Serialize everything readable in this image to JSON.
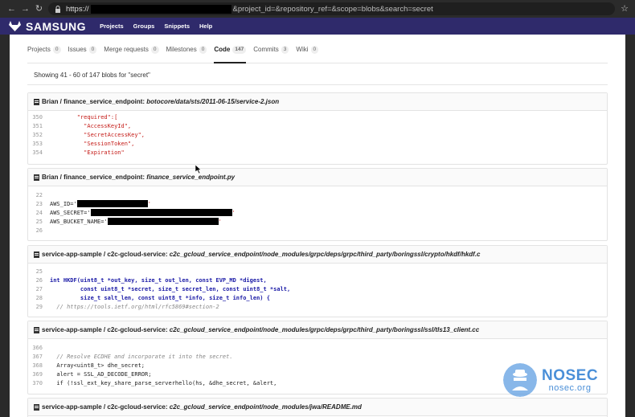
{
  "browser": {
    "url_prefix": "https://",
    "url_suffix": "&project_id=&repository_ref=&scope=blobs&search=secret"
  },
  "header": {
    "brand": "SAMSUNG",
    "menu": [
      "Projects",
      "Groups",
      "Snippets",
      "Help"
    ]
  },
  "tabs": [
    {
      "label": "Projects",
      "count": "0"
    },
    {
      "label": "Issues",
      "count": "0"
    },
    {
      "label": "Merge requests",
      "count": "0"
    },
    {
      "label": "Milestones",
      "count": "0"
    },
    {
      "label": "Code",
      "count": "147"
    },
    {
      "label": "Commits",
      "count": "3"
    },
    {
      "label": "Wiki",
      "count": "0"
    }
  ],
  "summary": "Showing 41 - 60 of 147 blobs for \"secret\"",
  "blobs": [
    {
      "project": "Brian / finance_service_endpoint:",
      "path": "botocore/data/sts/2011-06-15/service-2.json",
      "lines": [
        {
          "n": "350",
          "t": "        \"required\":["
        },
        {
          "n": "351",
          "t": "          \"AccessKeyId\","
        },
        {
          "n": "352",
          "t": "          \"SecretAccessKey\","
        },
        {
          "n": "353",
          "t": "          \"SessionToken\","
        },
        {
          "n": "354",
          "t": "          \"Expiration\""
        }
      ]
    },
    {
      "project": "Brian / finance_service_endpoint:",
      "path": "finance_service_endpoint.py",
      "lines": [
        {
          "n": "22",
          "t": ""
        },
        {
          "n": "23",
          "t": "AWS_ID='"
        },
        {
          "n": "24",
          "t": "AWS_SECRET='"
        },
        {
          "n": "25",
          "t": "AWS_BUCKET_NAME='"
        },
        {
          "n": "26",
          "t": ""
        }
      ]
    },
    {
      "project": "service-app-sample / c2c-gcloud-service:",
      "path": "c2c_gcloud_service_endpoint/node_modules/grpc/deps/grpc/third_party/boringssl/crypto/hkdf/hkdf.c",
      "lines": [
        {
          "n": "25",
          "t": ""
        },
        {
          "n": "26",
          "t": "int HKDF(uint8_t *out_key, size_t out_len, const EVP_MD *digest,"
        },
        {
          "n": "27",
          "t": "         const uint8_t *secret, size_t secret_len, const uint8_t *salt,"
        },
        {
          "n": "28",
          "t": "         size_t salt_len, const uint8_t *info, size_t info_len) {"
        },
        {
          "n": "29",
          "t": "  // https://tools.ietf.org/html/rfc5869#section-2"
        }
      ]
    },
    {
      "project": "service-app-sample / c2c-gcloud-service:",
      "path": "c2c_gcloud_service_endpoint/node_modules/grpc/deps/grpc/third_party/boringssl/ssl/tls13_client.cc",
      "lines": [
        {
          "n": "366",
          "t": ""
        },
        {
          "n": "367",
          "t": "  // Resolve ECDHE and incorporate it into the secret."
        },
        {
          "n": "368",
          "t": "  Array<uint8_t> dhe_secret;"
        },
        {
          "n": "369",
          "t": "  alert = SSL_AD_DECODE_ERROR;"
        },
        {
          "n": "370",
          "t": "  if (!ssl_ext_key_share_parse_serverhello(hs, &dhe_secret, &alert,"
        }
      ]
    },
    {
      "project": "service-app-sample / c2c-gcloud-service:",
      "path": "c2c_gcloud_service_endpoint/node_modules/jwa/README.md",
      "lines": []
    }
  ],
  "watermark": {
    "title": "NOSEC",
    "subtitle": "nosec.org"
  }
}
